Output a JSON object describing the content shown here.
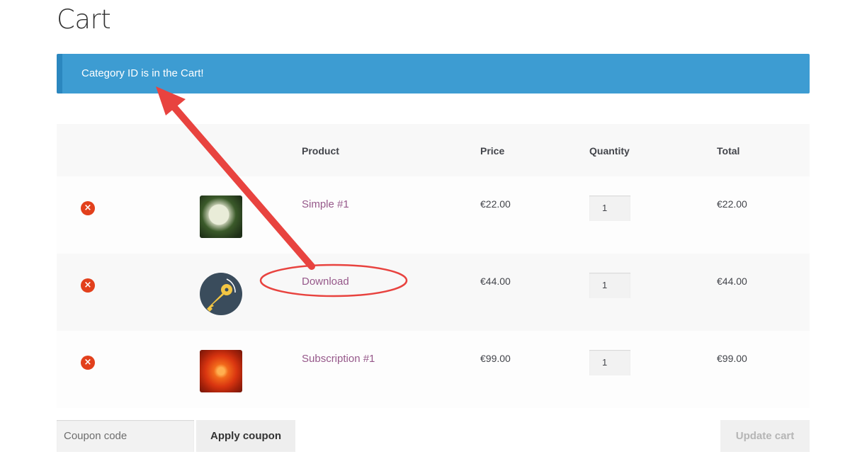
{
  "page": {
    "title": "Cart"
  },
  "notice": {
    "message": "Category ID is in the Cart!"
  },
  "table": {
    "headers": {
      "product": "Product",
      "price": "Price",
      "quantity": "Quantity",
      "total": "Total"
    },
    "rows": [
      {
        "name": "Simple #1",
        "price": "€22.00",
        "quantity": "1",
        "total": "€22.00",
        "thumbnail": "hydrangea-flower-image"
      },
      {
        "name": "Download",
        "price": "€44.00",
        "quantity": "1",
        "total": "€44.00",
        "thumbnail": "key-icon"
      },
      {
        "name": "Subscription #1",
        "price": "€99.00",
        "quantity": "1",
        "total": "€99.00",
        "thumbnail": "red-flower-image"
      }
    ],
    "remove_icon": "×"
  },
  "coupon": {
    "placeholder": "Coupon code",
    "apply_label": "Apply coupon"
  },
  "update_label": "Update cart",
  "colors": {
    "notice_bg": "#3d9cd2",
    "link": "#96588a",
    "remove": "#e2401c",
    "annotation": "#e8433f"
  }
}
